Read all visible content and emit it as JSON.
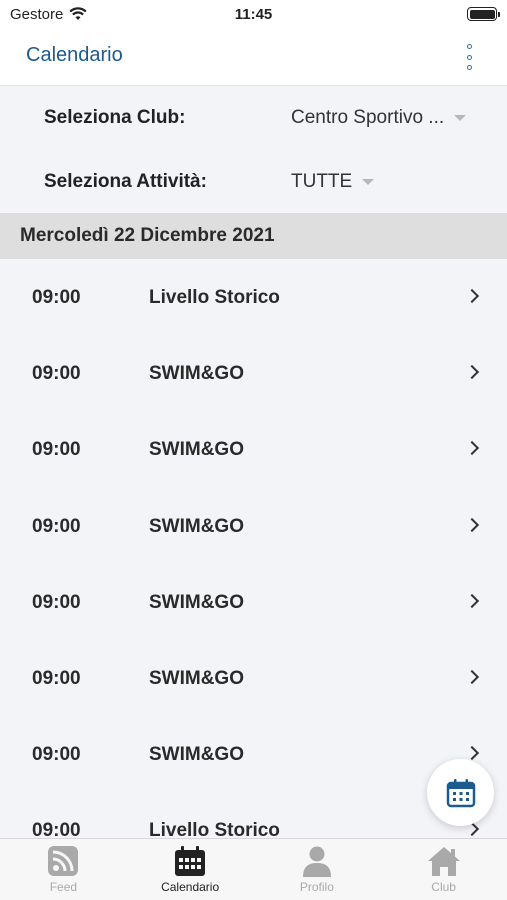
{
  "status_bar": {
    "carrier": "Gestore",
    "time": "11:45"
  },
  "header": {
    "title": "Calendario",
    "menu_icon": "more-vertical-icon"
  },
  "filters": {
    "club_label": "Seleziona Club:",
    "club_value": "Centro Sportivo ...",
    "activity_label": "Seleziona Attività:",
    "activity_value": "TUTTE"
  },
  "schedule": {
    "date": "Mercoledì 22 Dicembre 2021",
    "items": [
      {
        "time": "09:00",
        "name": "Livello Storico"
      },
      {
        "time": "09:00",
        "name": "SWIM&GO"
      },
      {
        "time": "09:00",
        "name": "SWIM&GO"
      },
      {
        "time": "09:00",
        "name": "SWIM&GO"
      },
      {
        "time": "09:00",
        "name": "SWIM&GO"
      },
      {
        "time": "09:00",
        "name": "SWIM&GO"
      },
      {
        "time": "09:00",
        "name": "SWIM&GO"
      },
      {
        "time": "09:00",
        "name": "Livello Storico"
      }
    ]
  },
  "tab_bar": {
    "tabs": [
      {
        "label": "Feed",
        "icon": "rss-feed-icon",
        "active": false
      },
      {
        "label": "Calendario",
        "icon": "calendar-icon",
        "active": true
      },
      {
        "label": "Profilo",
        "icon": "user-icon",
        "active": false
      },
      {
        "label": "Club",
        "icon": "home-icon",
        "active": false
      }
    ]
  },
  "colors": {
    "accent": "#1d5a8e",
    "inactive_tab": "#a9a9a9",
    "date_header_bg": "#dedede"
  }
}
